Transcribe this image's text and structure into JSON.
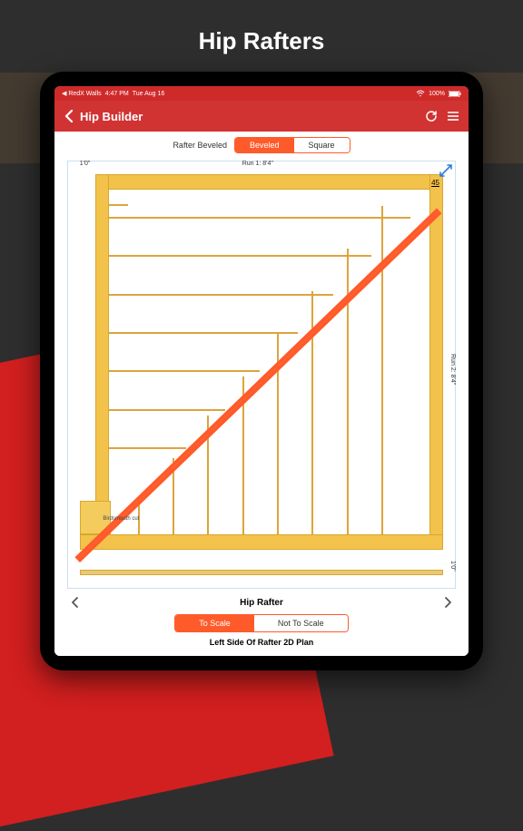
{
  "hero": {
    "title": "Hip Rafters"
  },
  "status": {
    "back_app": "RedX Walls",
    "time": "4:47 PM",
    "date": "Tue Aug 16",
    "battery": "100%"
  },
  "nav": {
    "title": "Hip Builder"
  },
  "rafter_beveled": {
    "label": "Rafter Beveled",
    "options": [
      "Beveled",
      "Square"
    ],
    "selected": "Beveled"
  },
  "diagram": {
    "run1_label": "Run 1: 8'4\"",
    "run2_label": "Run 2: 8'4\"",
    "overhang_left": "1'0\"",
    "overhang_right": "1'0\"",
    "angle": "45",
    "birdsmouth": "Birdsmouth cut"
  },
  "bottom": {
    "hip_rafter": "Hip Rafter",
    "scale_options": [
      "To Scale",
      "Not To Scale"
    ],
    "scale_selected": "To Scale",
    "plan_label": "Left Side Of Rafter 2D Plan"
  }
}
